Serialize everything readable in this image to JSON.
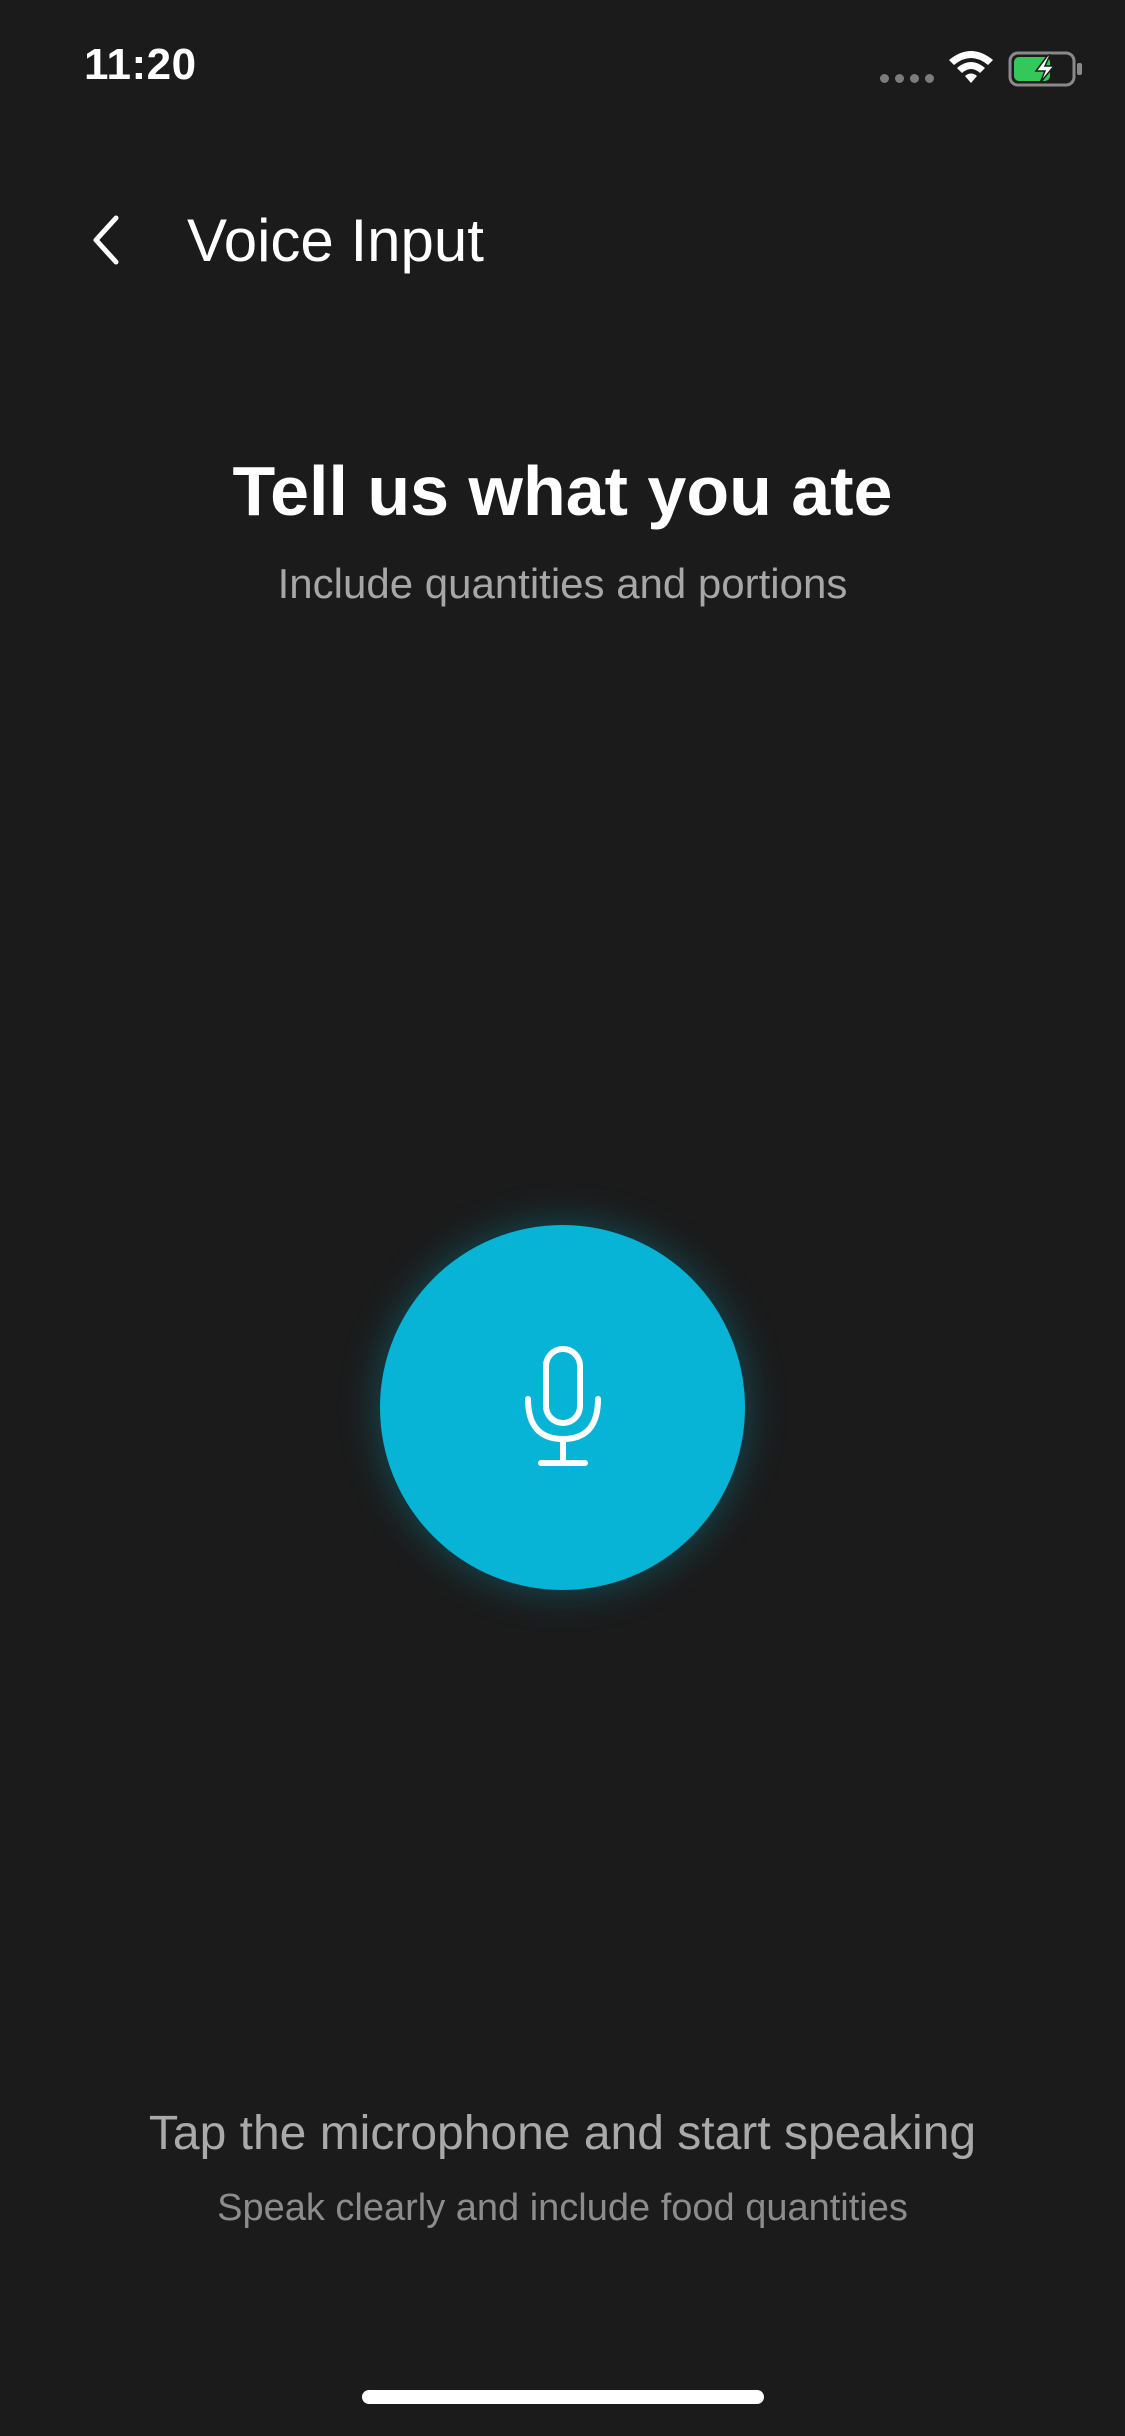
{
  "status_bar": {
    "time": "11:20",
    "icons": [
      "cellular-signal-icon",
      "wifi-icon",
      "battery-charging-icon"
    ],
    "battery_color": "#34c759"
  },
  "header": {
    "title": "Voice Input",
    "back_icon": "chevron-left-icon"
  },
  "prompt": {
    "title": "Tell us what you ate",
    "subtitle": "Include quantities and portions"
  },
  "mic_button": {
    "icon": "microphone-icon",
    "color": "#07b4d5"
  },
  "hints": {
    "primary": "Tap the microphone and start speaking",
    "secondary": "Speak clearly and include food quantities"
  },
  "colors": {
    "background": "#1b1b1b",
    "accent": "#07b4d5",
    "text_primary": "#ffffff",
    "text_secondary": "#a7a7a7"
  }
}
